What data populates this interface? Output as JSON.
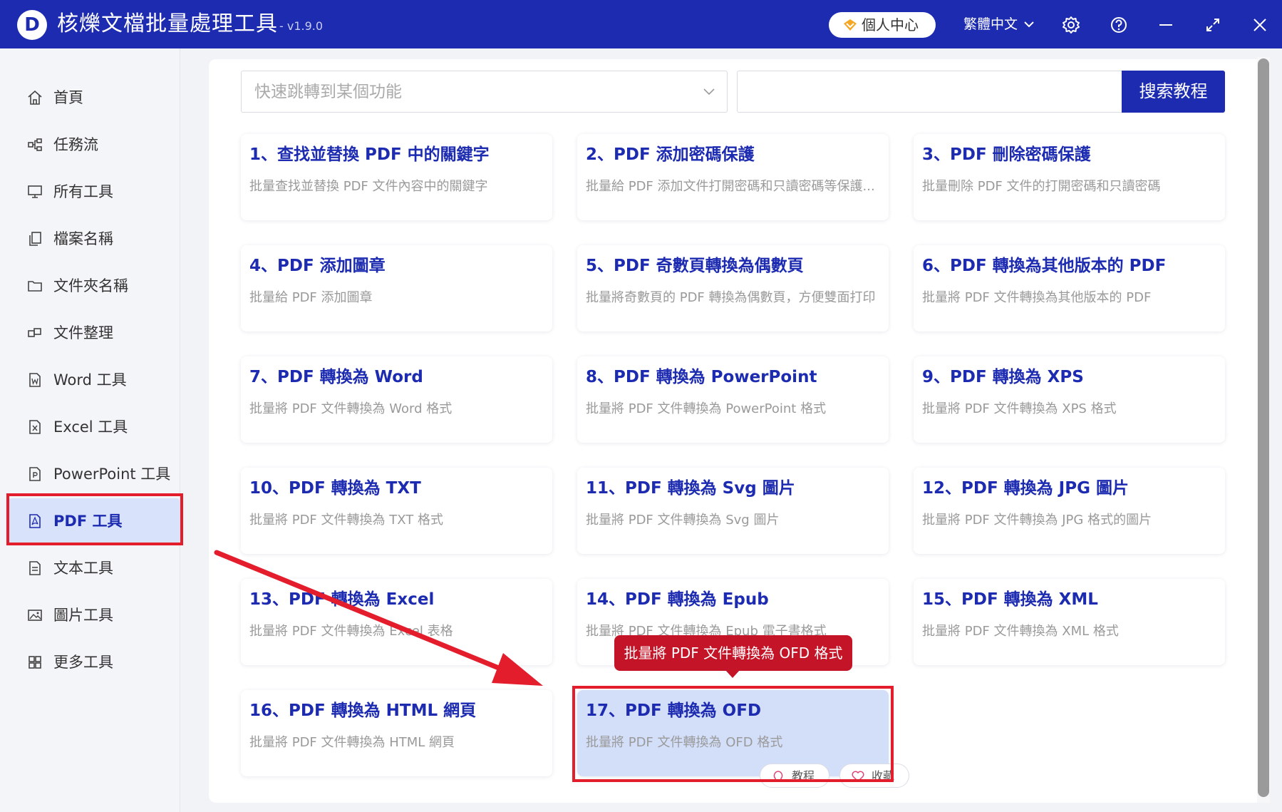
{
  "window": {
    "title": "核爍文檔批量處理工具",
    "version": "- v1.9.0",
    "logo_letter": "D",
    "user_center_label": "個人中心",
    "language_label": "繁體中文",
    "icons": [
      "crown-icon",
      "chevron-down-icon",
      "gear-icon",
      "help-icon",
      "minimize-icon",
      "expand-icon",
      "close-icon"
    ]
  },
  "sidebar": {
    "items": [
      {
        "label": "首頁",
        "icon": "home-icon",
        "active": false
      },
      {
        "label": "任務流",
        "icon": "workflow-icon",
        "active": false
      },
      {
        "label": "所有工具",
        "icon": "monitor-icon",
        "active": false
      },
      {
        "label": "檔案名稱",
        "icon": "file-copy-icon",
        "active": false
      },
      {
        "label": "文件夾名稱",
        "icon": "folder-icon",
        "active": false
      },
      {
        "label": "文件整理",
        "icon": "organize-icon",
        "active": false
      },
      {
        "label": "Word 工具",
        "icon": "word-doc-icon",
        "active": false
      },
      {
        "label": "Excel 工具",
        "icon": "excel-doc-icon",
        "active": false
      },
      {
        "label": "PowerPoint 工具",
        "icon": "ppt-doc-icon",
        "active": false
      },
      {
        "label": "PDF 工具",
        "icon": "pdf-doc-icon",
        "active": true
      },
      {
        "label": "文本工具",
        "icon": "text-doc-icon",
        "active": false
      },
      {
        "label": "圖片工具",
        "icon": "image-icon",
        "active": false
      },
      {
        "label": "更多工具",
        "icon": "grid-icon",
        "active": false
      }
    ]
  },
  "search": {
    "select_placeholder": "快速跳轉到某個功能",
    "input_value": "",
    "button_label": "搜索教程"
  },
  "cards": [
    {
      "title": "1、查找並替換 PDF 中的關鍵字",
      "desc": "批量查找並替換 PDF 文件內容中的關鍵字"
    },
    {
      "title": "2、PDF 添加密碼保護",
      "desc": "批量給 PDF 添加文件打開密碼和只讀密碼等保護..."
    },
    {
      "title": "3、PDF 刪除密碼保護",
      "desc": "批量刪除 PDF 文件的打開密碼和只讀密碼"
    },
    {
      "title": "4、PDF 添加圖章",
      "desc": "批量給 PDF 添加圖章"
    },
    {
      "title": "5、PDF 奇數頁轉換為偶數頁",
      "desc": "批量將奇數頁的 PDF 轉換為偶數頁，方便雙面打印"
    },
    {
      "title": "6、PDF 轉換為其他版本的 PDF",
      "desc": "批量將 PDF 文件轉換為其他版本的 PDF"
    },
    {
      "title": "7、PDF 轉換為 Word",
      "desc": "批量將 PDF 文件轉換為 Word 格式"
    },
    {
      "title": "8、PDF 轉換為 PowerPoint",
      "desc": "批量將 PDF 文件轉換為 PowerPoint 格式"
    },
    {
      "title": "9、PDF 轉換為 XPS",
      "desc": "批量將 PDF 文件轉換為 XPS 格式"
    },
    {
      "title": "10、PDF 轉換為 TXT",
      "desc": "批量將 PDF 文件轉換為 TXT 格式"
    },
    {
      "title": "11、PDF 轉換為 Svg 圖片",
      "desc": "批量將 PDF 文件轉換為 Svg 圖片"
    },
    {
      "title": "12、PDF 轉換為 JPG 圖片",
      "desc": "批量將 PDF 文件轉換為 JPG 格式的圖片"
    },
    {
      "title": "13、PDF 轉換為 Excel",
      "desc": "批量將 PDF 文件轉換為 Excel 表格"
    },
    {
      "title": "14、PDF 轉換為 Epub",
      "desc": "批量將 PDF 文件轉換為 Epub 電子書格式"
    },
    {
      "title": "15、PDF 轉換為 XML",
      "desc": "批量將 PDF 文件轉換為 XML 格式"
    },
    {
      "title": "16、PDF 轉換為 HTML 網頁",
      "desc": "批量將 PDF 文件轉換為 HTML 網頁"
    },
    {
      "title": "17、PDF 轉換為 OFD",
      "desc": "批量將 PDF 文件轉換為 OFD 格式",
      "highlighted": true
    }
  ],
  "card_actions": {
    "tutorial_label": "教程",
    "favorite_label": "收藏"
  },
  "tooltip": {
    "text": "批量將 PDF 文件轉換為 OFD 格式"
  },
  "colors": {
    "brand": "#1c2bb0",
    "annotation_red": "#e31d2c",
    "tooltip_red": "#c41528",
    "highlight": "#d3def9"
  }
}
